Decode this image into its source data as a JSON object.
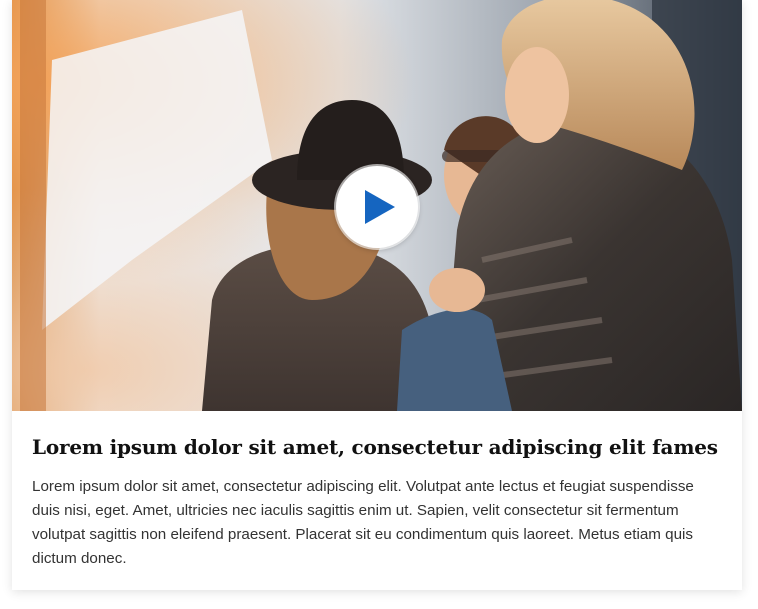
{
  "card": {
    "image_alt": "Three women laughing together outdoors",
    "play_button": "play-icon",
    "title": "Lorem ipsum dolor sit amet, consectetur adipiscing elit fames",
    "body": "Lorem ipsum dolor sit amet, consectetur adipiscing elit. Volutpat ante lectus et feugiat suspendisse duis nisi, eget. Amet, ultricies nec iaculis sagittis enim ut. Sapien, velit consectetur sit fermentum volutpat sagittis non eleifend praesent. Placerat sit eu condimentum quis laoreet. Metus etiam quis dictum donec."
  },
  "colors": {
    "play_accent": "#1565c0",
    "title": "#111111",
    "body": "#333333"
  }
}
